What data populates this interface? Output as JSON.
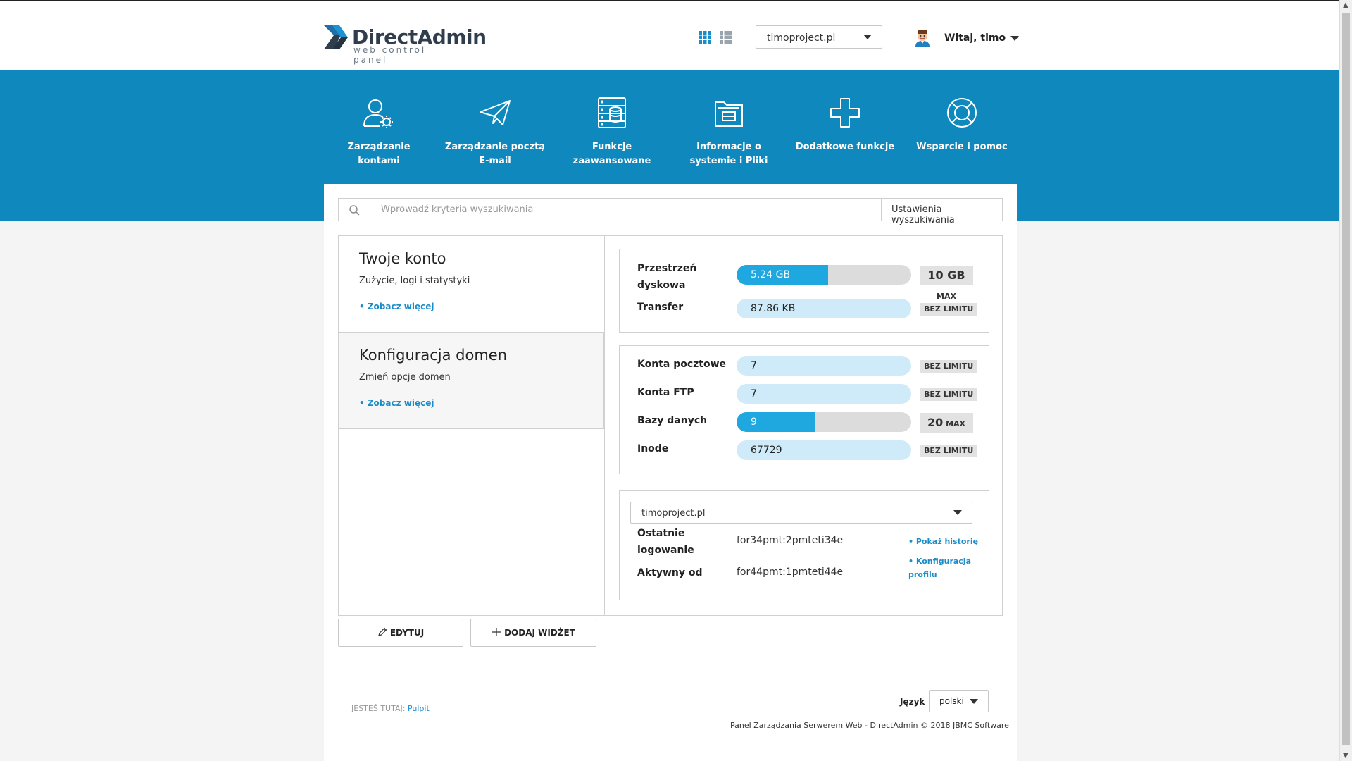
{
  "header": {
    "logo_name": "DirectAdmin",
    "logo_sub": "web control panel",
    "domain_selected": "timoproject.pl",
    "welcome": "Witaj, timo"
  },
  "nav": [
    {
      "label_line1": "Zarządzanie",
      "label_line2": "kontami",
      "icon": "user-gear-icon"
    },
    {
      "label_line1": "Zarządzanie pocztą",
      "label_line2": "E-mail",
      "icon": "paper-plane-icon"
    },
    {
      "label_line1": "Funkcje",
      "label_line2": "zaawansowane",
      "icon": "server-icon"
    },
    {
      "label_line1": "Informacje o",
      "label_line2": "systemie i Pliki",
      "icon": "folder-icon"
    },
    {
      "label_line1": "Dodatkowe funkcje",
      "label_line2": "",
      "icon": "plus-icon"
    },
    {
      "label_line1": "Wsparcie i pomoc",
      "label_line2": "",
      "icon": "lifebuoy-icon"
    }
  ],
  "search": {
    "placeholder": "Wprowadź kryteria wyszukiwania",
    "settings_label": "Ustawienia wyszukiwania"
  },
  "cards": [
    {
      "title": "Twoje konto",
      "desc": "Zużycie, logi i statystyki",
      "more": "• Zobacz więcej"
    },
    {
      "title": "Konfiguracja domen",
      "desc": "Zmień opcje domen",
      "more": "• Zobacz więcej"
    }
  ],
  "buttons": {
    "edit": "EDYTUJ",
    "add_widget": "DODAJ WIDŻET"
  },
  "usage": {
    "disk": {
      "label_line1": "Przestrzeń",
      "label_line2": "dyskowa",
      "value": "5.24 GB",
      "limit_big": "10 GB",
      "limit_small": "MAX",
      "fraction": 0.524
    },
    "transfer": {
      "label": "Transfer",
      "value": "87.86 KB",
      "limit": "BEZ LIMITU"
    }
  },
  "accounts": {
    "email": {
      "label": "Konta pocztowe",
      "value": "7",
      "limit": "BEZ LIMITU"
    },
    "ftp": {
      "label": "Konta FTP",
      "value": "7",
      "limit": "BEZ LIMITU"
    },
    "db": {
      "label": "Bazy danych",
      "value": "9",
      "limit_big": "20",
      "limit_small": "MAX",
      "fraction": 0.45
    },
    "inode": {
      "label": "Inode",
      "value": "67729",
      "limit": "BEZ LIMITU"
    }
  },
  "profile": {
    "domain": "timoproject.pl",
    "last_login_line1": "Ostatnie",
    "last_login_line2": "logowanie",
    "last_login_value": "for34pmt:2pmteti34e",
    "history_link": "• Pokaż historię",
    "active_since_label": "Aktywny od",
    "active_since_value": "for44pmt:1pmteti44e",
    "profile_link_line1": "• Konfiguracja",
    "profile_link_line2": "profilu"
  },
  "footer": {
    "crumb_label": "JESTEŚ TUTAJ:",
    "crumb_link": "Pulpit",
    "language_label": "Język",
    "language_value": "polski",
    "copyright": "Panel Zarządzania Serwerem Web - DirectAdmin © 2018 JBMC Software"
  },
  "colors": {
    "brand_blue": "#0f88be",
    "bar_fill": "#1fa7e0",
    "bar_light": "#cfeaf8",
    "link": "#1a8cc8"
  }
}
